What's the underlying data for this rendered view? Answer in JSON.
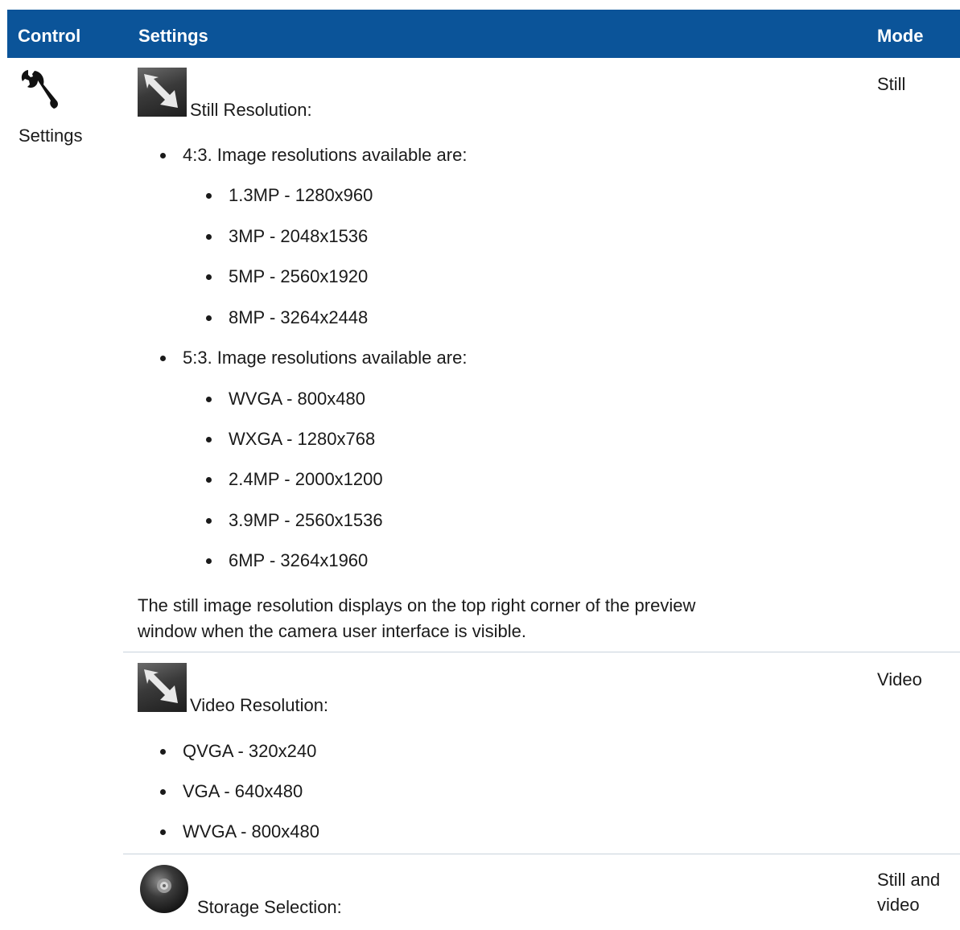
{
  "header": {
    "control": "Control",
    "settings": "Settings",
    "mode": "Mode"
  },
  "control_label": "Settings",
  "rows": [
    {
      "icon": "resize-arrows-icon",
      "title": "Still Resolution:",
      "mode": "Still",
      "groups": [
        {
          "label": "4:3. Image resolutions available are:",
          "items": [
            "1.3MP - 1280x960",
            "3MP - 2048x1536",
            "5MP - 2560x1920",
            "8MP - 3264x2448"
          ]
        },
        {
          "label": "5:3. Image resolutions available are:",
          "items": [
            "WVGA - 800x480",
            "WXGA - 1280x768",
            "2.4MP - 2000x1200",
            "3.9MP - 2560x1536",
            "6MP - 3264x1960"
          ]
        }
      ],
      "note_line1": "The still image resolution displays on the top right corner of the preview",
      "note_line2": "window when the camera user interface is visible."
    },
    {
      "icon": "resize-arrows-icon",
      "title": "Video Resolution:",
      "mode": "Video",
      "items": [
        "QVGA - 320x240",
        "VGA - 640x480",
        "WVGA - 800x480"
      ]
    },
    {
      "icon": "storage-disc-icon",
      "title": "Storage Selection:",
      "mode_line1": "Still and",
      "mode_line2": "video"
    }
  ],
  "colors": {
    "header_bg": "#0b5499",
    "header_text": "#ffffff",
    "divider": "#c8d3dc"
  }
}
